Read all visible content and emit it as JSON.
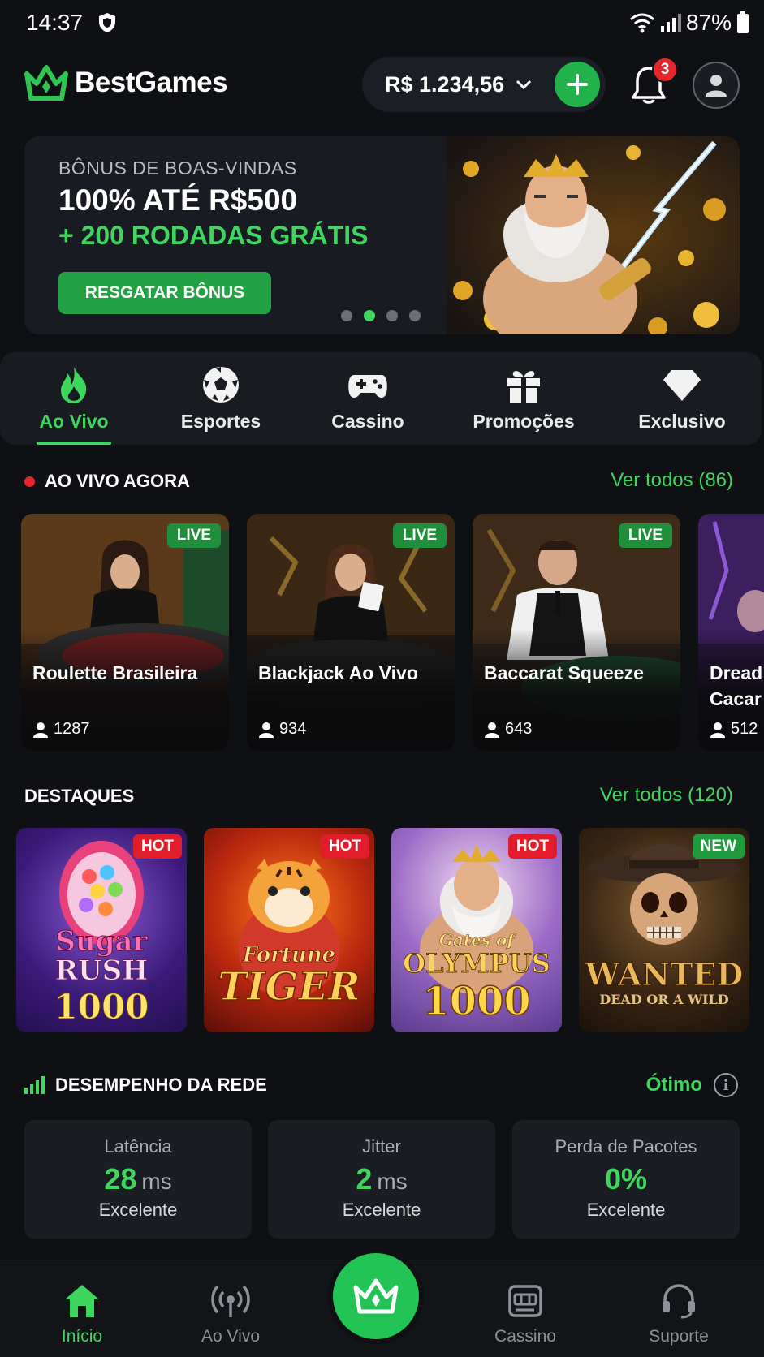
{
  "status_bar": {
    "time": "14:37",
    "battery": "87%"
  },
  "header": {
    "brand": "BestGames",
    "balance": "R$ 1.234,56",
    "notification_count": "3"
  },
  "banner": {
    "eyebrow": "BÔNUS DE BOAS-VINDAS",
    "title": "100% ATÉ R$500",
    "subtitle": "+ 200 RODADAS GRÁTIS",
    "cta": "RESGATAR BÔNUS",
    "active_slide": 2,
    "slide_count": 4
  },
  "categories": [
    {
      "label": "Ao Vivo",
      "icon": "flame-icon",
      "active": true
    },
    {
      "label": "Esportes",
      "icon": "soccer-ball-icon",
      "active": false
    },
    {
      "label": "Cassino",
      "icon": "gamepad-icon",
      "active": false
    },
    {
      "label": "Promoções",
      "icon": "gift-icon",
      "active": false
    },
    {
      "label": "Exclusivo",
      "icon": "diamond-icon",
      "active": false
    }
  ],
  "live_section": {
    "title": "AO VIVO AGORA",
    "see_all": "Ver todos (86)",
    "badge": "LIVE",
    "cards": [
      {
        "name": "Roulette Brasileira",
        "viewers": "1287"
      },
      {
        "name": "Blackjack Ao Vivo",
        "viewers": "934"
      },
      {
        "name": "Baccarat Squeeze",
        "viewers": "643"
      },
      {
        "name": "Dread Cacar",
        "viewers": "512"
      }
    ]
  },
  "featured_section": {
    "title": "DESTAQUES",
    "see_all": "Ver todos (120)",
    "games": [
      {
        "tag": "HOT",
        "logo_line1": "Sugar",
        "logo_line2": "RUSH",
        "logo_line3": "1000"
      },
      {
        "tag": "HOT",
        "logo_line1": "Fortune",
        "logo_line2": "TIGER",
        "logo_line3": ""
      },
      {
        "tag": "HOT",
        "logo_line1": "Gates of",
        "logo_line2": "OLYMPUS",
        "logo_line3": "1000"
      },
      {
        "tag": "NEW",
        "logo_line1": "",
        "logo_line2": "WANTED",
        "logo_line3": "DEAD OR A WILD"
      }
    ]
  },
  "network": {
    "title": "DESEMPENHO DA REDE",
    "status": "Ótimo",
    "info_glyph": "i",
    "stats": [
      {
        "label": "Latência",
        "value": "28",
        "unit": "ms",
        "quality": "Excelente"
      },
      {
        "label": "Jitter",
        "value": "2",
        "unit": "ms",
        "quality": "Excelente"
      },
      {
        "label": "Perda de Pacotes",
        "value": "0%",
        "unit": "",
        "quality": "Excelente"
      }
    ]
  },
  "bottom_nav": {
    "items": [
      {
        "label": "Início",
        "icon": "home-icon",
        "active": true
      },
      {
        "label": "Ao Vivo",
        "icon": "broadcast-icon",
        "active": false
      },
      {
        "label": "Cassino",
        "icon": "slot-machine-icon",
        "active": false
      },
      {
        "label": "Suporte",
        "icon": "headset-icon",
        "active": false
      }
    ]
  },
  "colors": {
    "accent": "#3ed65f",
    "live_red": "#e5262d",
    "background": "#0e1013",
    "card": "#1a1d22"
  }
}
